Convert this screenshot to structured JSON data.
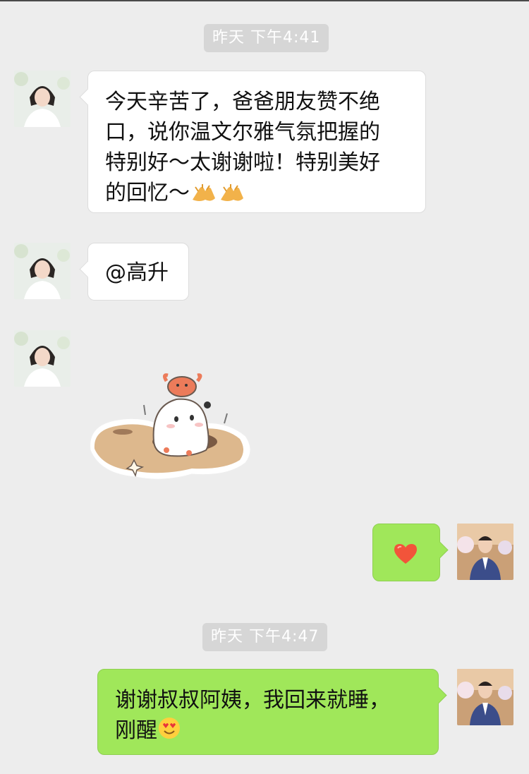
{
  "timestamps": [
    "昨天 下午4:41",
    "昨天 下午4:47"
  ],
  "messages": [
    {
      "side": "left",
      "text": "今天辛苦了，爸爸朋友赞不绝口，说你温文尔雅气氛把握的特别好～太谢谢啦！特别美好的回忆～",
      "emoji": [
        "clapping-hands",
        "clapping-hands"
      ]
    },
    {
      "side": "left",
      "text": "@高升"
    },
    {
      "side": "left",
      "type": "sticker",
      "sticker": "ghost-with-crab-in-sand"
    },
    {
      "side": "right",
      "type": "emoji",
      "emoji": "red-heart"
    },
    {
      "side": "right",
      "text": "谢谢叔叔阿姨，我回来就睡，刚醒",
      "emoji": [
        "smiling-face-with-heart-eyes"
      ]
    }
  ],
  "lines": {
    "msg1": [
      "今天辛苦了，爸爸朋友赞不绝",
      "口，说你温文尔雅气氛把握的",
      "特别好～太谢谢啦！特别美好",
      "的回忆～"
    ],
    "msg5": [
      "谢谢叔叔阿姨，我回来就睡，",
      "刚醒"
    ]
  },
  "colors": {
    "background": "#ededed",
    "outgoing_bubble": "#a0e75a",
    "incoming_bubble": "#ffffff",
    "timestamp_pill": "#d6d6d6"
  }
}
